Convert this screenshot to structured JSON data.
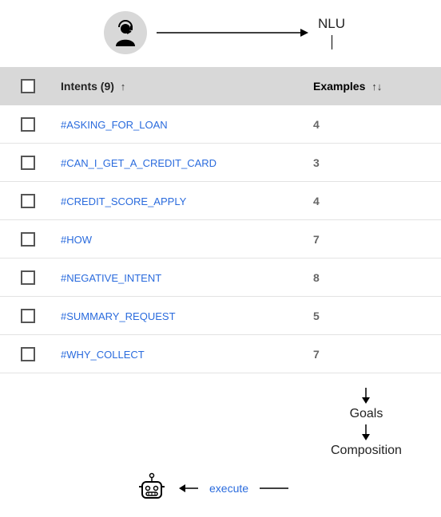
{
  "top": {
    "nlu_label": "NLU"
  },
  "table": {
    "intents_header": "Intents (9)",
    "examples_header": "Examples",
    "rows": [
      {
        "intent": "#ASKING_FOR_LOAN",
        "examples": "4"
      },
      {
        "intent": "#CAN_I_GET_A_CREDIT_CARD",
        "examples": "3"
      },
      {
        "intent": "#CREDIT_SCORE_APPLY",
        "examples": "4"
      },
      {
        "intent": "#HOW",
        "examples": "7"
      },
      {
        "intent": "#NEGATIVE_INTENT",
        "examples": "8"
      },
      {
        "intent": "#SUMMARY_REQUEST",
        "examples": "5"
      },
      {
        "intent": "#WHY_COLLECT",
        "examples": "7"
      }
    ]
  },
  "flow": {
    "goals": "Goals",
    "composition": "Composition",
    "execute": "execute"
  }
}
